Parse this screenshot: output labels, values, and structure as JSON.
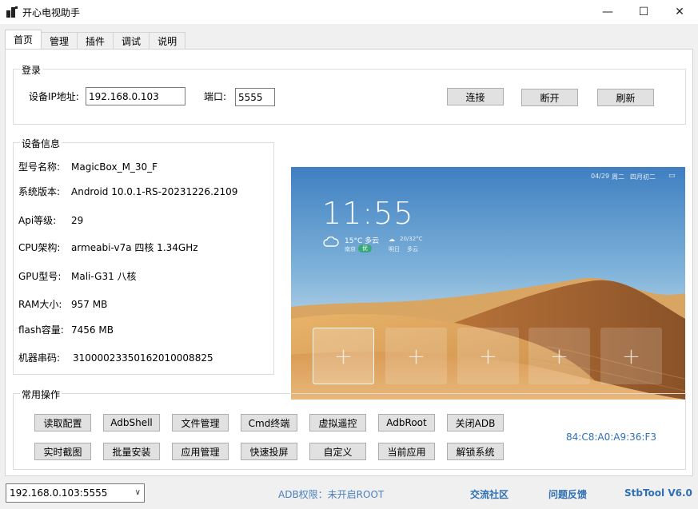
{
  "window": {
    "title": "开心电视助手",
    "minimize": "—",
    "maximize": "☐",
    "close": "✕"
  },
  "tabs": [
    {
      "label": "首页",
      "active": true
    },
    {
      "label": "管理"
    },
    {
      "label": "插件"
    },
    {
      "label": "调试"
    },
    {
      "label": "说明"
    }
  ],
  "login": {
    "group_title": "登录",
    "ip_label": "设备IP地址:",
    "ip_value": "192.168.0.103",
    "port_label": "端口:",
    "port_value": "5555",
    "connect": "连接",
    "disconnect": "断开",
    "refresh": "刷新"
  },
  "device_info": {
    "group_title": "设备信息",
    "rows": [
      {
        "label": "型号名称:",
        "value": "MagicBox_M_30_F"
      },
      {
        "label": "系统版本:",
        "value": "Android 10.0.1-RS-20231226.2109"
      },
      {
        "label": "Api等级:",
        "value": "29"
      },
      {
        "label": "CPU架构:",
        "value": "armeabi-v7a 四核 1.34GHz"
      },
      {
        "label": "GPU型号:",
        "value": "Mali-G31 八核"
      },
      {
        "label": "RAM大小:",
        "value": "957 MB"
      },
      {
        "label": "flash容量:",
        "value": "7456 MB"
      },
      {
        "label": "机器串码:",
        "value": "31000023350162010008825"
      }
    ]
  },
  "tv_screen": {
    "date": "04/29",
    "weekday": "周二",
    "lunar": "四月初二",
    "time": "11:55",
    "temp_today": "15°C 多云",
    "city": "南京",
    "aqi": "优",
    "temp_tomorrow": "20/32°C",
    "tomorrow_label": "明日",
    "tomorrow_weather": "多云",
    "tiles": [
      "+",
      "+",
      "+",
      "+",
      "+"
    ]
  },
  "common_ops": {
    "group_title": "常用操作",
    "row1": [
      "读取配置",
      "AdbShell",
      "文件管理",
      "Cmd终端",
      "虚拟遥控",
      "AdbRoot",
      "关闭ADB"
    ],
    "row2": [
      "实时截图",
      "批量安装",
      "应用管理",
      "快速投屏",
      "自定义",
      "当前应用",
      "解锁系统"
    ],
    "mac": "84:C8:A0:A9:36:F3"
  },
  "status_bar": {
    "device_select": "192.168.0.103:5555",
    "adb_permission": "ADB权限：未开启ROOT",
    "community": "交流社区",
    "feedback": "问题反馈",
    "version": "StbTool V6.0"
  },
  "colors": {
    "link_blue": "#2f6fb5",
    "status_blue": "#4a7fc0"
  }
}
